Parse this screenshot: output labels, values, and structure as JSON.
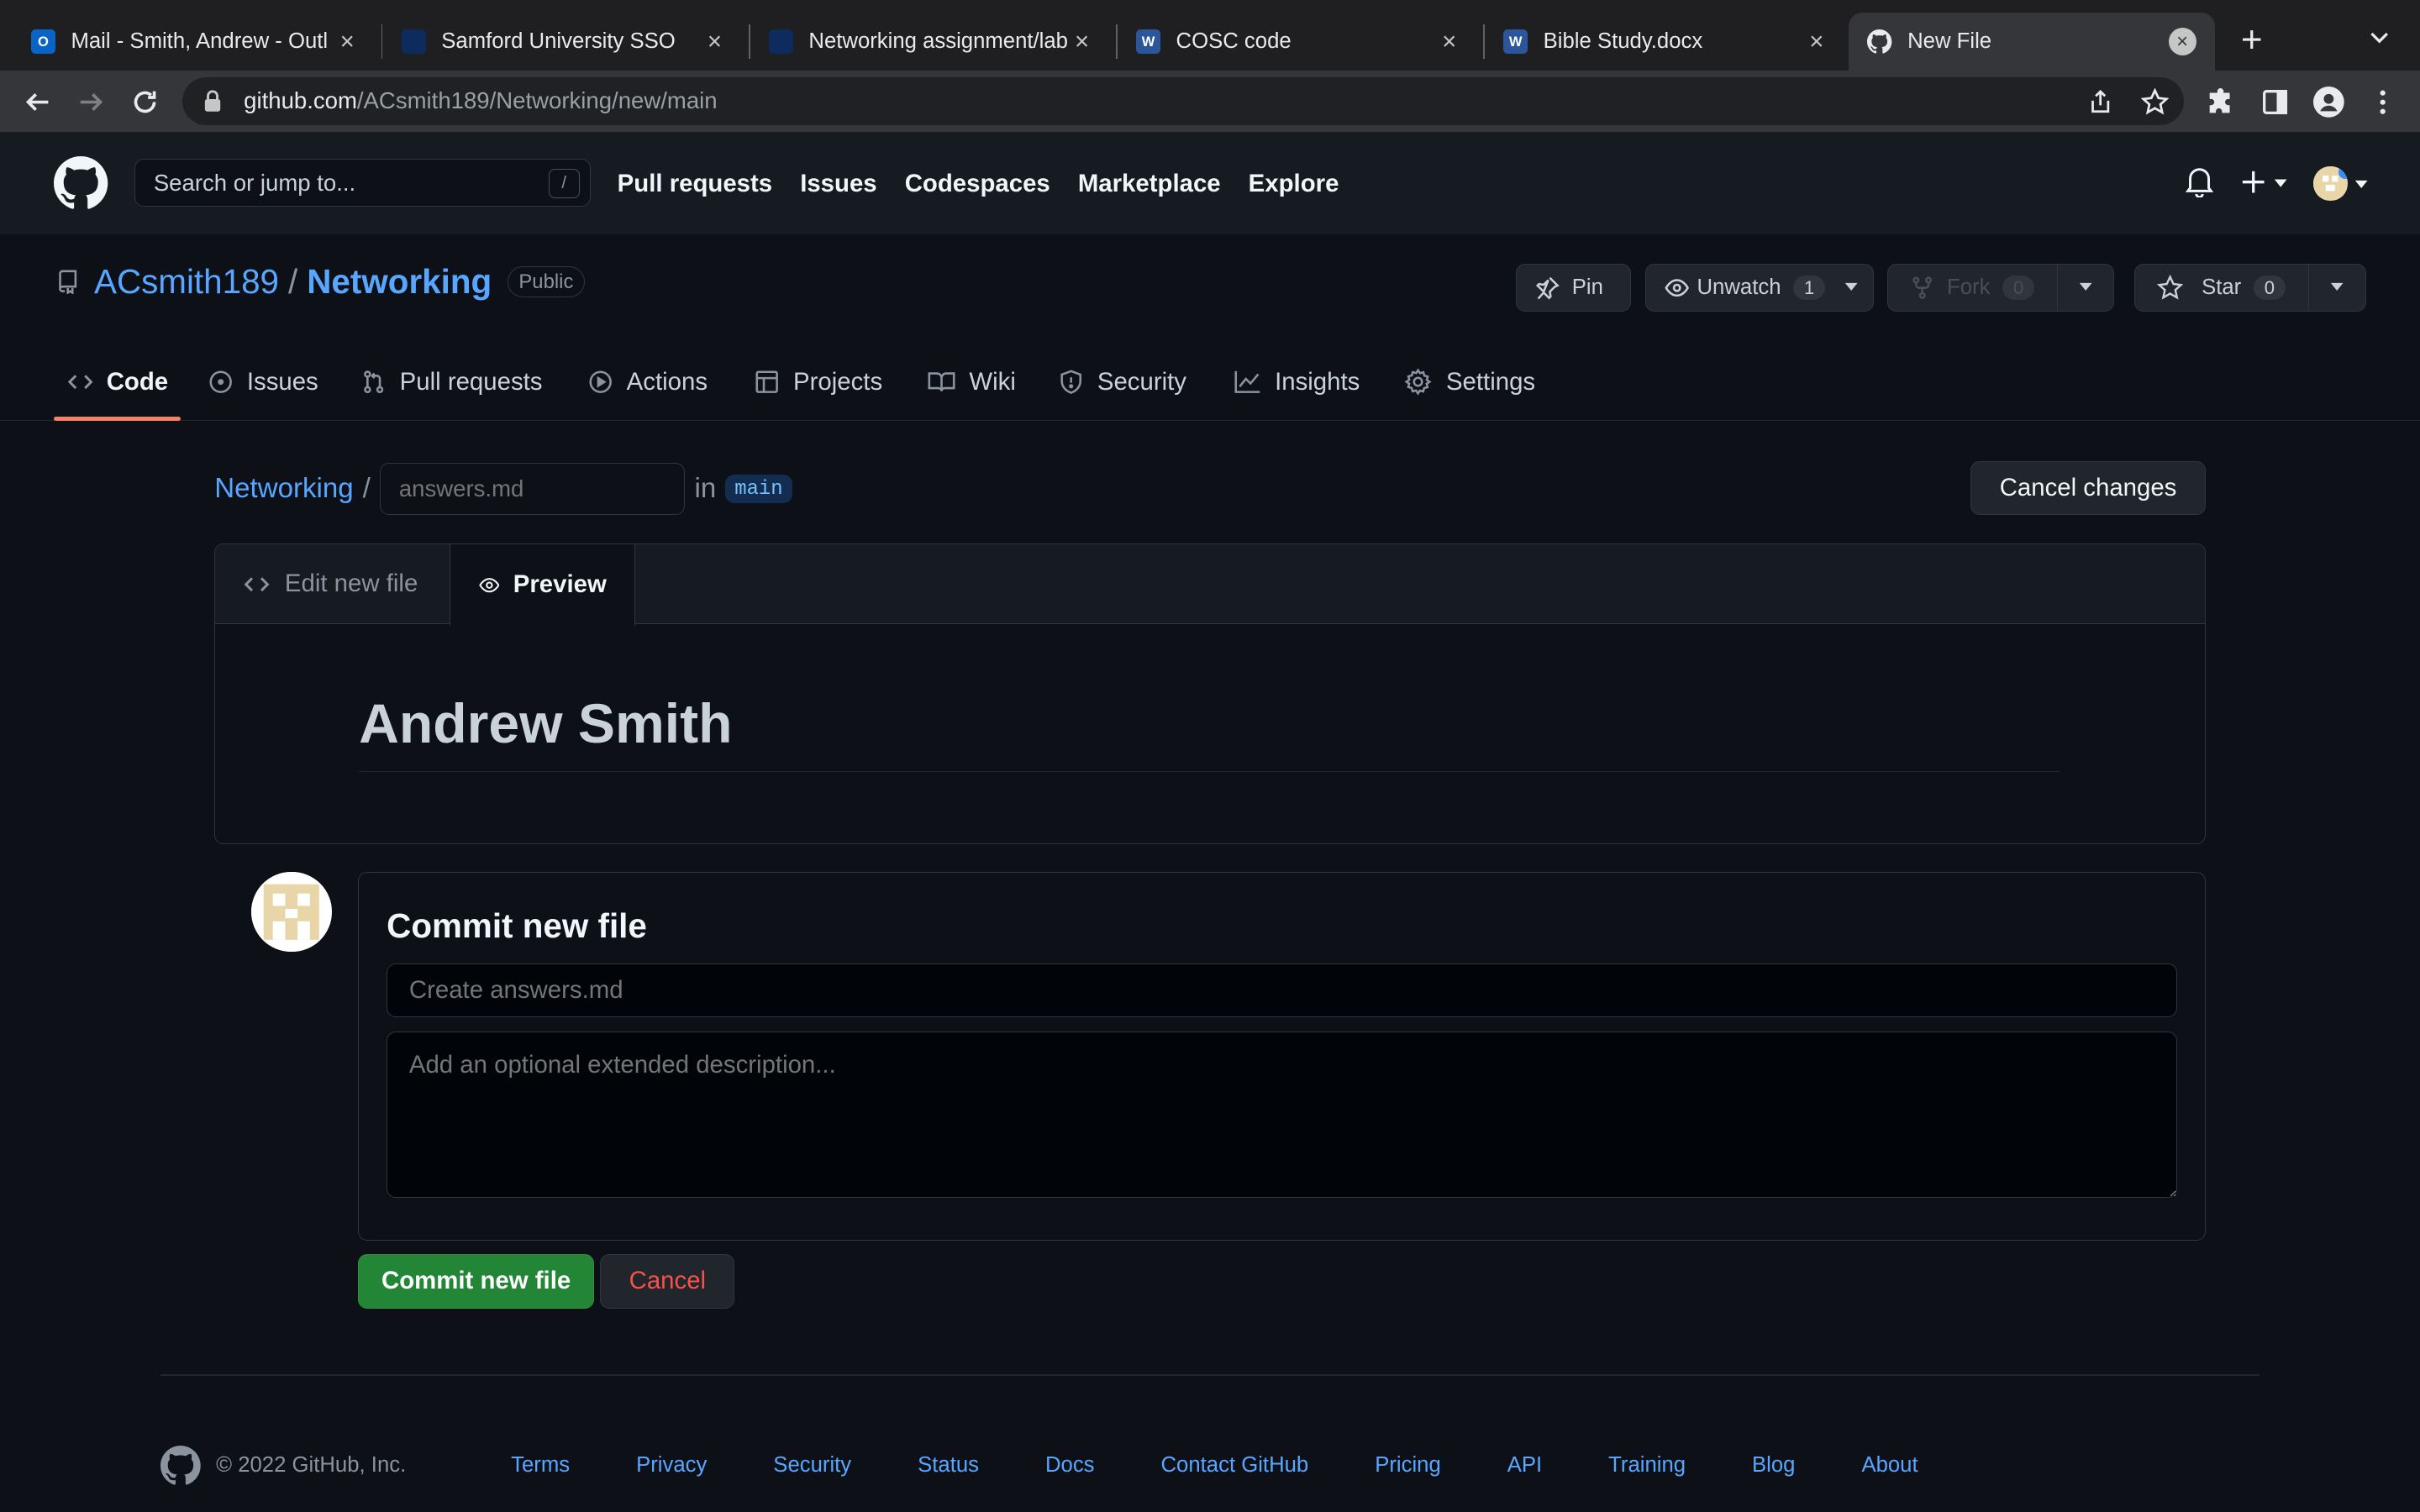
{
  "browser": {
    "tabs": [
      {
        "title": "Mail - Smith, Andrew - Outl",
        "icon": "outlook-icon"
      },
      {
        "title": "Samford University SSO",
        "icon": "samford-icon"
      },
      {
        "title": "Networking assignment/lab",
        "icon": "doc-icon"
      },
      {
        "title": "COSC code",
        "icon": "word-icon"
      },
      {
        "title": "Bible Study.docx",
        "icon": "word-icon"
      },
      {
        "title": "New File",
        "icon": "github-icon"
      }
    ],
    "url_host": "github.com",
    "url_path": "/ACsmith189/Networking/new/main"
  },
  "header": {
    "search_placeholder": "Search or jump to...",
    "search_shortcut": "/",
    "nav": [
      "Pull requests",
      "Issues",
      "Codespaces",
      "Marketplace",
      "Explore"
    ]
  },
  "repo": {
    "owner": "ACsmith189",
    "name": "Networking",
    "visibility": "Public",
    "pin_label": "Pin",
    "watch_label": "Unwatch",
    "watch_count": "1",
    "fork_label": "Fork",
    "fork_count": "0",
    "star_label": "Star",
    "star_count": "0"
  },
  "repo_nav": [
    "Code",
    "Issues",
    "Pull requests",
    "Actions",
    "Projects",
    "Wiki",
    "Security",
    "Insights",
    "Settings"
  ],
  "editor": {
    "repo_link": "Networking",
    "separator": "/",
    "filename_placeholder": "answers.md",
    "in_label": "in",
    "branch": "main",
    "cancel_changes": "Cancel changes",
    "tab_edit": "Edit new file",
    "tab_preview": "Preview",
    "preview_heading": "Andrew Smith"
  },
  "commit": {
    "title": "Commit new file",
    "message_placeholder": "Create answers.md",
    "description_placeholder": "Add an optional extended description...",
    "commit_button": "Commit new file",
    "cancel_button": "Cancel"
  },
  "footer": {
    "copyright": "© 2022 GitHub, Inc.",
    "links": [
      "Terms",
      "Privacy",
      "Security",
      "Status",
      "Docs",
      "Contact GitHub",
      "Pricing",
      "API",
      "Training",
      "Blog",
      "About"
    ]
  },
  "colors": {
    "accent_link": "#58a6ff",
    "commit_green": "#238636",
    "danger": "#f85149",
    "tab_underline": "#f78166"
  }
}
